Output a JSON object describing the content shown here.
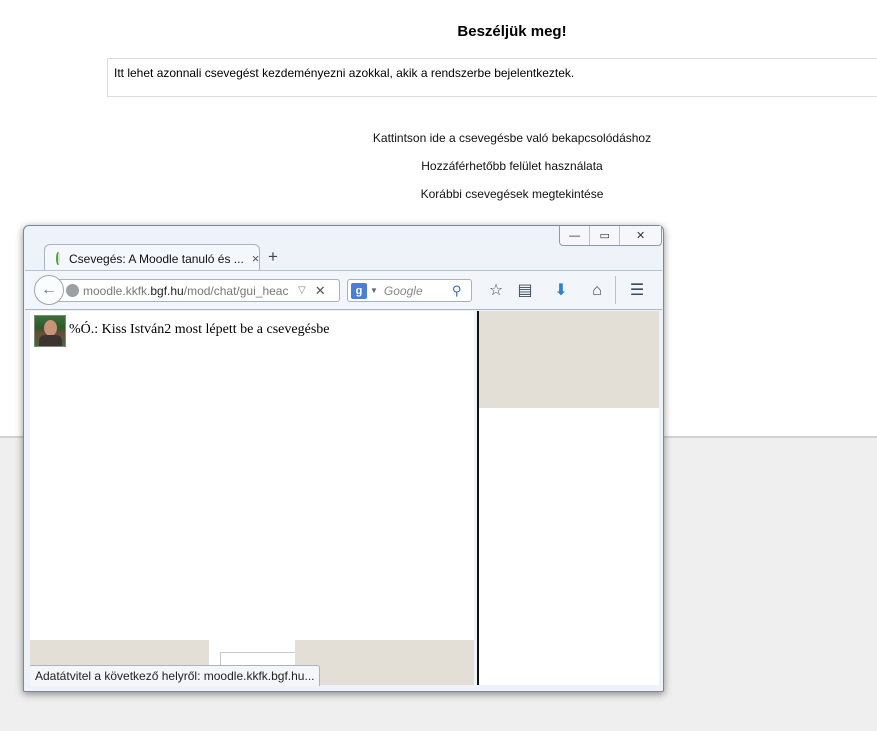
{
  "page": {
    "title": "Beszéljük meg!",
    "intro": "Itt lehet azonnali csevegést kezdeményezni azokkal, akik a rendszerbe bejelentkeztek.",
    "links": [
      "Kattintson ide a csevegésbe való bekapcsolódáshoz",
      "Hozzáférhetőbb felület használata",
      "Korábbi csevegések megtekintése"
    ]
  },
  "popup": {
    "window_controls": {
      "minimize": "—",
      "maximize": "▭",
      "close": "✕"
    },
    "tab": {
      "title": "Csevegés: A Moodle tanuló és ...",
      "close": "×",
      "new_tab": "+"
    },
    "url": {
      "prefix": "moodle.kkfk.",
      "domain": "bgf.hu",
      "path": "/mod/chat/gui_heac"
    },
    "search": {
      "engine_letter": "g",
      "placeholder": "Google"
    },
    "icons": {
      "back": "back-arrow-icon",
      "globe": "globe-icon",
      "bookmark": "star-icon",
      "reading_list": "clipboard-icon",
      "downloads": "download-arrow-icon",
      "home": "home-icon",
      "menu": "hamburger-menu-icon"
    },
    "colors": {
      "chrome_bg": "#eef3f9",
      "panel_beige": "#e3dfd6",
      "download_arrow": "#2f7fd3"
    },
    "chat": {
      "message": "%Ó.: Kiss István2 most lépett be a csevegésbe"
    },
    "status": "Adatátvitel a következő helyről: moodle.kkfk.bgf.hu..."
  }
}
